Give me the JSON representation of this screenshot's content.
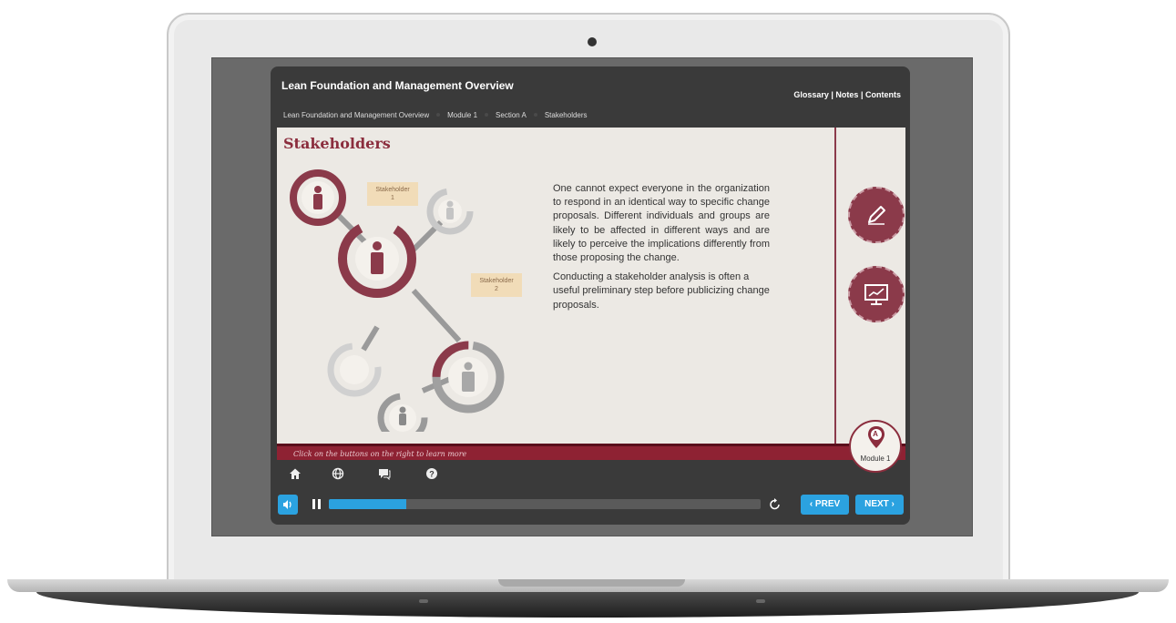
{
  "course": {
    "title": "Lean Foundation and Management Overview",
    "links": [
      "Glossary",
      "Notes",
      "Contents"
    ],
    "link_separator": "|",
    "breadcrumb": [
      "Lean Foundation and Management Overview",
      "Module 1",
      "Section A",
      "Stakeholders"
    ]
  },
  "slide": {
    "title": "Stakeholders",
    "paragraph1": "One cannot expect everyone in the organization to respond in an identical way to specific change proposals. Different individuals and groups are likely to be affected in different ways and are likely to perceive the implications differently from those proposing the change.",
    "paragraph2": "Conducting a stakeholder analysis is often a useful preliminary step before publicizing change proposals.",
    "stakeholder1_line1": "Stakeholder",
    "stakeholder1_line2": "1",
    "stakeholder2_line1": "Stakeholder",
    "stakeholder2_line2": "2"
  },
  "side": {
    "module_letter": "A",
    "module_label": "Module 1",
    "icons": [
      "pencil-icon",
      "presentation-chart-icon"
    ]
  },
  "hint": "Click on the buttons on the right to learn more",
  "toolbar_icons": [
    "home-icon",
    "globe-icon",
    "chat-icon",
    "help-icon"
  ],
  "player": {
    "progress": 0.18,
    "prev_label": "‹ PREV",
    "next_label": "NEXT ›"
  },
  "colors": {
    "accent_maroon": "#8b3a4a",
    "player_blue": "#2ba2e0",
    "header_dark": "#3a3a3a"
  }
}
